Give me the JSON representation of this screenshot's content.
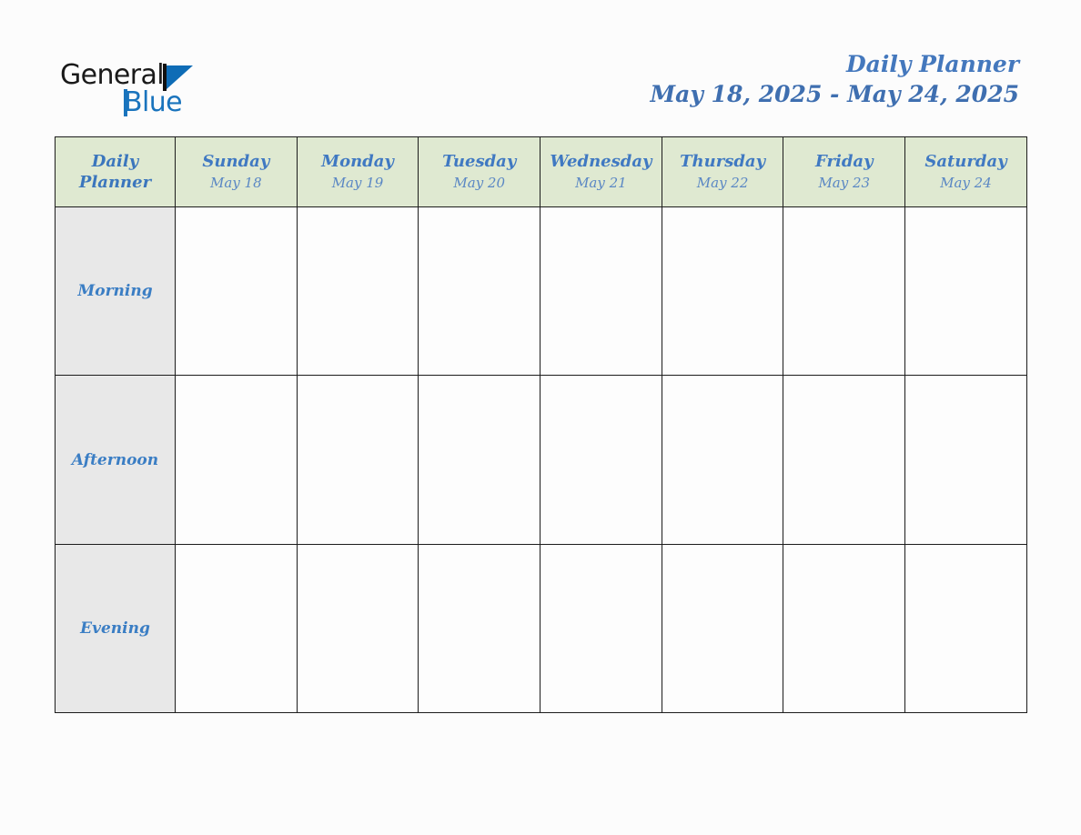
{
  "brand": {
    "logo_text_primary": "General",
    "logo_text_secondary": "Blue",
    "flag_icon": "blue-triangle-flag-icon"
  },
  "header": {
    "title": "Daily Planner",
    "date_range": "May 18, 2025 - May 24, 2025"
  },
  "colors": {
    "accent_blue": "#4079c2",
    "header_green": "#dfe9d1",
    "label_gray": "#e8e8e8",
    "logo_blue": "#1a74bd",
    "border": "#1c1c1c",
    "page_background": "#fcfcfc"
  },
  "table": {
    "corner": {
      "line1": "Daily",
      "line2": "Planner"
    },
    "columns": [
      {
        "day": "Sunday",
        "date": "May 18"
      },
      {
        "day": "Monday",
        "date": "May 19"
      },
      {
        "day": "Tuesday",
        "date": "May 20"
      },
      {
        "day": "Wednesday",
        "date": "May 21"
      },
      {
        "day": "Thursday",
        "date": "May 22"
      },
      {
        "day": "Friday",
        "date": "May 23"
      },
      {
        "day": "Saturday",
        "date": "May 24"
      }
    ],
    "rows": [
      {
        "label": "Morning",
        "cells": [
          "",
          "",
          "",
          "",
          "",
          "",
          ""
        ]
      },
      {
        "label": "Afternoon",
        "cells": [
          "",
          "",
          "",
          "",
          "",
          "",
          ""
        ]
      },
      {
        "label": "Evening",
        "cells": [
          "",
          "",
          "",
          "",
          "",
          "",
          ""
        ]
      }
    ]
  }
}
